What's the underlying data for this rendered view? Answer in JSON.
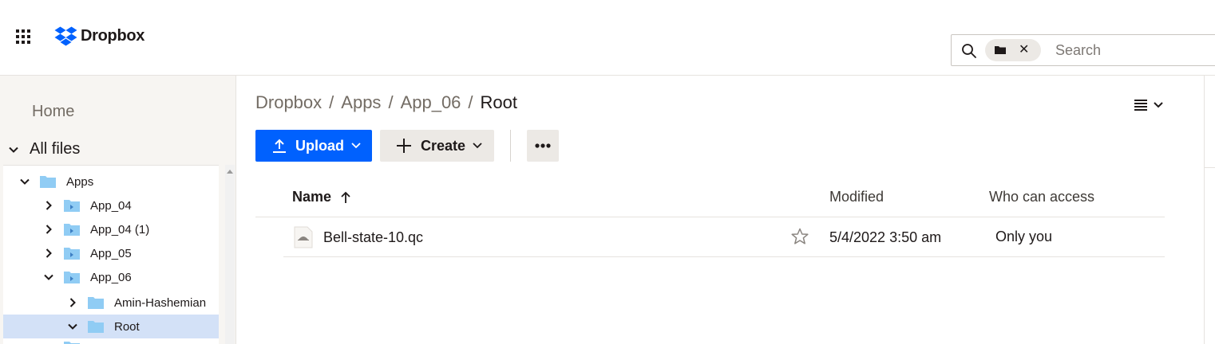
{
  "brand": {
    "name": "Dropbox",
    "accent": "#0061fe"
  },
  "search": {
    "placeholder": "Search",
    "scope_icon": "folder-icon"
  },
  "sidebar": {
    "home": "Home",
    "all_files": "All files",
    "tree": [
      {
        "label": "Apps",
        "expanded": true
      },
      {
        "label": "App_04",
        "expanded": false
      },
      {
        "label": "App_04 (1)",
        "expanded": false
      },
      {
        "label": "App_05",
        "expanded": false
      },
      {
        "label": "App_06",
        "expanded": true
      },
      {
        "label": "Amin-Hashemian",
        "expanded": false
      },
      {
        "label": "Root",
        "expanded": true,
        "selected": true
      }
    ]
  },
  "breadcrumb": {
    "items": [
      "Dropbox",
      "Apps",
      "App_06"
    ],
    "separator": "/",
    "current": "Root"
  },
  "toolbar": {
    "upload": "Upload",
    "create": "Create"
  },
  "table": {
    "headers": {
      "name": "Name",
      "modified": "Modified",
      "access": "Who can access"
    },
    "rows": [
      {
        "name": "Bell-state-10.qc",
        "modified": "5/4/2022 3:50 am",
        "access": "Only you",
        "starred": false
      }
    ]
  }
}
